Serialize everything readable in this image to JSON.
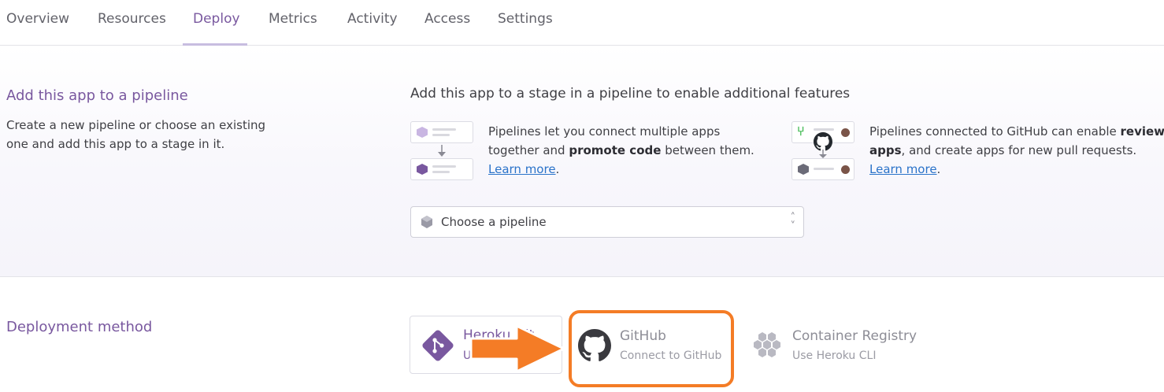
{
  "tabs": [
    {
      "label": "Overview",
      "active": false
    },
    {
      "label": "Resources",
      "active": false
    },
    {
      "label": "Deploy",
      "active": true
    },
    {
      "label": "Metrics",
      "active": false
    },
    {
      "label": "Activity",
      "active": false
    },
    {
      "label": "Access",
      "active": false
    },
    {
      "label": "Settings",
      "active": false
    }
  ],
  "pipeline": {
    "title": "Add this app to a pipeline",
    "description_line1": "Create a new pipeline or choose an existing",
    "description_line2": "one and add this app to a stage in it.",
    "heading": "Add this app to a stage in a pipeline to enable additional features",
    "feature1": {
      "line1": "Pipelines let you connect multiple apps",
      "line2_pre": "together and ",
      "line2_bold": "promote code",
      "line2_post": " between them.",
      "link": "Learn more",
      "link_suffix": "."
    },
    "feature2": {
      "line1_pre": "Pipelines connected to GitHub can enable ",
      "line1_bold": "review",
      "line2_bold": "apps",
      "line2_post": ", and create apps for new pull requests.",
      "link": "Learn more",
      "link_suffix": "."
    },
    "select_placeholder": "Choose a pipeline"
  },
  "deployment": {
    "title": "Deployment method",
    "options": [
      {
        "title": "Heroku Git",
        "subtitle": "Use Heroku CLI",
        "icon": "git-icon"
      },
      {
        "title": "GitHub",
        "subtitle": "Connect to GitHub",
        "icon": "github-icon"
      },
      {
        "title": "Container Registry",
        "subtitle": "Use Heroku CLI",
        "icon": "container-registry-icon"
      }
    ]
  },
  "colors": {
    "accent": "#79589f",
    "link": "#2a73c9",
    "annotation": "#f47c26"
  }
}
